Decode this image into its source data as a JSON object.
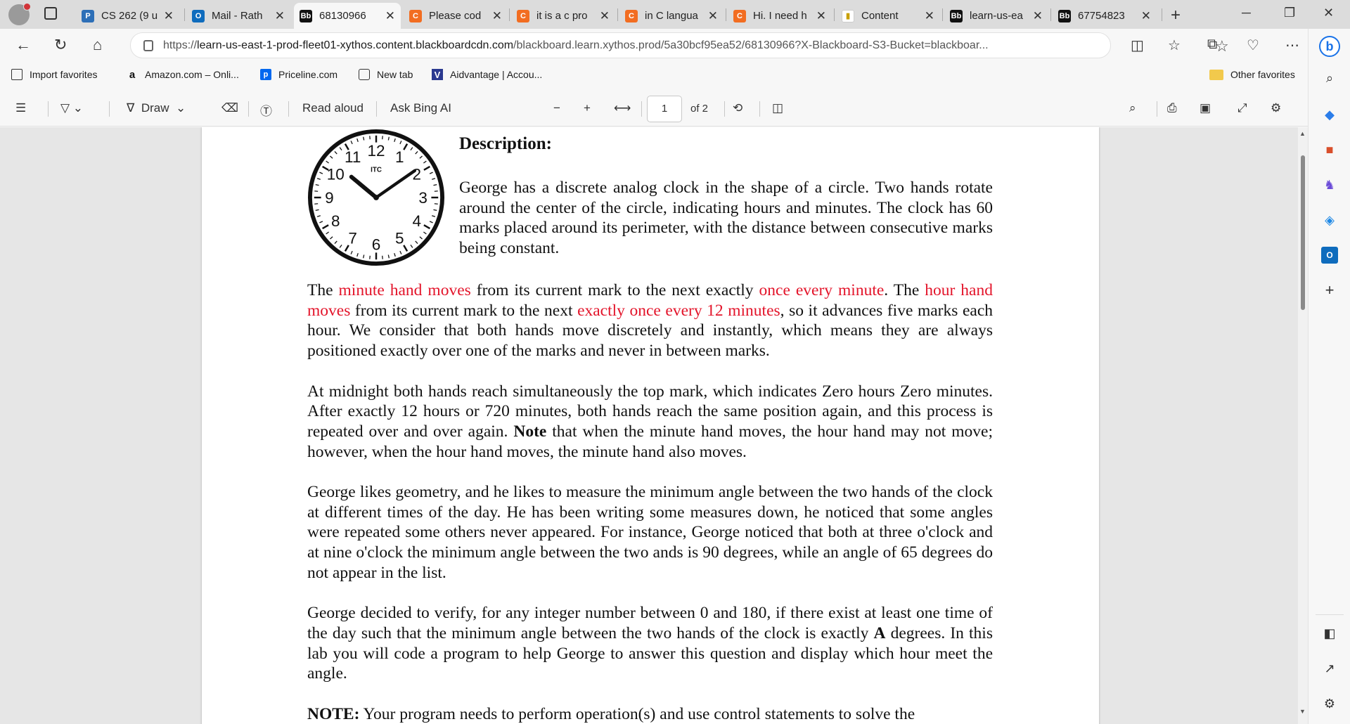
{
  "browser": {
    "tabs": [
      {
        "label": "CS 262 (9 u",
        "favicon": "P",
        "color": "#2d6fb7"
      },
      {
        "label": "Mail - Rath",
        "favicon": "O",
        "color": "#0f6cbd"
      },
      {
        "label": "68130966",
        "favicon": "Bb",
        "color": "#111111"
      },
      {
        "label": "Please cod",
        "favicon": "C",
        "color": "#f26d21"
      },
      {
        "label": "it is a c pro",
        "favicon": "C",
        "color": "#f26d21"
      },
      {
        "label": "in C langua",
        "favicon": "C",
        "color": "#f26d21"
      },
      {
        "label": "Hi. I need h",
        "favicon": "C",
        "color": "#f26d21"
      },
      {
        "label": "Content",
        "favicon": "▮",
        "color": "#c8a000"
      },
      {
        "label": "learn-us-ea",
        "favicon": "Bb",
        "color": "#111111"
      },
      {
        "label": "67754823",
        "favicon": "Bb",
        "color": "#111111"
      }
    ],
    "url_prefix": "https://",
    "url_host": "learn-us-east-1-prod-fleet01-xythos.content.blackboardcdn.com",
    "url_rest": "/blackboard.learn.xythos.prod/5a30bcf95ea52/68130966?X-Blackboard-S3-Bucket=blackboar...",
    "favorites": [
      {
        "label": "Import favorites",
        "icon": "import-icon"
      },
      {
        "label": "Amazon.com – Onli...",
        "icon": "amazon-icon"
      },
      {
        "label": "Priceline.com",
        "icon": "priceline-icon"
      },
      {
        "label": "New tab",
        "icon": "newtab-icon"
      },
      {
        "label": "Aidvantage | Accou...",
        "icon": "aidvantage-icon"
      }
    ],
    "other_favorites": "Other favorites"
  },
  "pdf_toolbar": {
    "draw": "Draw",
    "read_aloud": "Read aloud",
    "ask_bing": "Ask Bing AI",
    "page_current": "1",
    "page_total": "of 2"
  },
  "document": {
    "clock": {
      "brand": "ITC",
      "numbers": [
        "12",
        "1",
        "2",
        "3",
        "4",
        "5",
        "6",
        "7",
        "8",
        "9",
        "10",
        "11"
      ]
    },
    "heading": "Description:",
    "intro": "George has a discrete analog clock in the shape of a circle. Two hands rotate around the center of the circle, indicating hours and minutes. The clock has 60 marks placed around its perimeter, with the distance between consecutive marks being constant.",
    "p1": {
      "a": "The ",
      "b": "minute hand moves",
      "c": " from its current mark to the next exactly ",
      "d": "once every minute",
      "e": ". The ",
      "f": "hour hand moves",
      "g": " from its current mark to the next ",
      "h": "exactly once every 12 minutes",
      "i": ", so it advances five marks each hour. We consider that both hands move discretely and instantly, which means they are always positioned exactly over one of the marks and never in between marks."
    },
    "p2": {
      "a": "At midnight both hands reach simultaneously the top mark, which indicates Zero hours Zero minutes. After exactly 12 hours or 720 minutes, both hands reach the same position again, and this process is repeated over and over again. ",
      "b": "Note",
      "c": " that when the minute hand moves, the hour hand may not move; however, when the hour hand moves, the minute hand also moves."
    },
    "p3": "George likes geometry, and he likes to measure the minimum angle between the two hands of the clock at different times of the day. He has been writing some measures down, he noticed that some angles were repeated some others never appeared. For instance, George noticed that both at three o'clock and at nine o'clock the minimum angle between the two ands is 90 degrees, while an angle of 65 degrees do not appear in the list.",
    "p4": {
      "a": "George decided to verify, for any integer number between 0 and 180, if there exist at least one time of the day such that the minimum angle between the two hands of the clock is exactly ",
      "b": "A",
      "c": " degrees. In this lab you will code a program to help George to answer this question and display which hour meet the angle."
    },
    "p5": {
      "a": "NOTE:",
      "b": " Your program needs to perform operation(s) and use control statements to solve the"
    }
  }
}
